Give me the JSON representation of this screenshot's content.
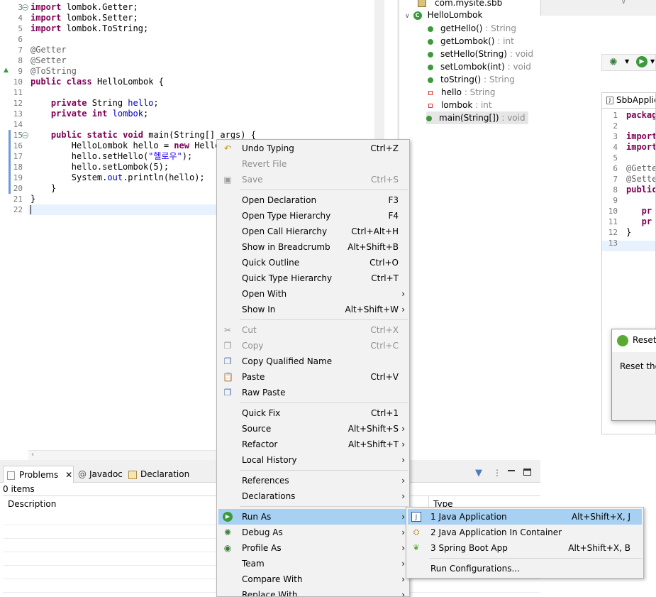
{
  "editor": {
    "lines": [
      {
        "n": "3",
        "code": [
          [
            "kw",
            "import"
          ],
          [
            "",
            " lombok.Getter;"
          ]
        ],
        "fold": true
      },
      {
        "n": "4",
        "code": [
          [
            "kw",
            "import"
          ],
          [
            "",
            " lombok.Setter;"
          ]
        ]
      },
      {
        "n": "5",
        "code": [
          [
            "kw",
            "import"
          ],
          [
            "",
            " lombok.ToString;"
          ]
        ]
      },
      {
        "n": "6",
        "code": []
      },
      {
        "n": "7",
        "code": [
          [
            "ann",
            "@Getter"
          ]
        ]
      },
      {
        "n": "8",
        "code": [
          [
            "ann",
            "@Setter"
          ]
        ]
      },
      {
        "n": "9",
        "code": [
          [
            "ann",
            "@ToString"
          ]
        ]
      },
      {
        "n": "10",
        "code": [
          [
            "kw",
            "public"
          ],
          [
            "",
            " "
          ],
          [
            "kw",
            "class"
          ],
          [
            "",
            " HelloLombok {"
          ]
        ]
      },
      {
        "n": "11",
        "code": []
      },
      {
        "n": "12",
        "code": [
          [
            "",
            "    "
          ],
          [
            "kw",
            "private"
          ],
          [
            "",
            " String "
          ],
          [
            "fld",
            "hello"
          ],
          [
            "",
            ";"
          ]
        ]
      },
      {
        "n": "13",
        "code": [
          [
            "",
            "    "
          ],
          [
            "kw",
            "private"
          ],
          [
            "",
            " "
          ],
          [
            "kw",
            "int"
          ],
          [
            "",
            " "
          ],
          [
            "fld",
            "lombok"
          ],
          [
            "",
            ";"
          ]
        ]
      },
      {
        "n": "14",
        "code": []
      },
      {
        "n": "15",
        "code": [
          [
            "",
            "    "
          ],
          [
            "kw",
            "public"
          ],
          [
            "",
            " "
          ],
          [
            "kw",
            "static"
          ],
          [
            "",
            " "
          ],
          [
            "kw",
            "void"
          ],
          [
            "",
            " main(String[] args) {"
          ]
        ],
        "fold": true
      },
      {
        "n": "16",
        "code": [
          [
            "",
            "        HelloLombok hello = "
          ],
          [
            "kw",
            "new"
          ],
          [
            "",
            " HelloL"
          ]
        ]
      },
      {
        "n": "17",
        "code": [
          [
            "",
            "        hello.setHello("
          ],
          [
            "str",
            "\"헬로우\""
          ],
          [
            "",
            ");"
          ]
        ]
      },
      {
        "n": "18",
        "code": [
          [
            "",
            "        hello.setLombok(5);"
          ]
        ]
      },
      {
        "n": "19",
        "code": [
          [
            "",
            "        System."
          ],
          [
            "fld",
            "out"
          ],
          [
            "",
            ".println(hello);"
          ]
        ]
      },
      {
        "n": "20",
        "code": [
          [
            "",
            "    }"
          ]
        ]
      },
      {
        "n": "21",
        "code": [
          [
            "",
            "}"
          ]
        ]
      },
      {
        "n": "22",
        "code": []
      }
    ]
  },
  "outline": {
    "package": "com.mysite.sbb",
    "class": "HelloLombok",
    "members": [
      {
        "name": "getHello()",
        "type": " : String",
        "kind": "method"
      },
      {
        "name": "getLombok()",
        "type": " : int",
        "kind": "method"
      },
      {
        "name": "setHello(String)",
        "type": " : void",
        "kind": "method"
      },
      {
        "name": "setLombok(int)",
        "type": " : void",
        "kind": "method"
      },
      {
        "name": "toString()",
        "type": " : String",
        "kind": "method"
      },
      {
        "name": "hello",
        "type": " : String",
        "kind": "field"
      },
      {
        "name": "lombok",
        "type": " : int",
        "kind": "field"
      },
      {
        "name": "main(String[])",
        "type": " : void",
        "kind": "method"
      }
    ]
  },
  "right": {
    "tab_label": "SbbApplica",
    "lines": [
      {
        "n": "1",
        "code": [
          [
            "kw",
            "packag"
          ]
        ]
      },
      {
        "n": "2",
        "code": []
      },
      {
        "n": "3",
        "code": [
          [
            "kw",
            "import"
          ]
        ]
      },
      {
        "n": "4",
        "code": [
          [
            "kw",
            "import"
          ]
        ]
      },
      {
        "n": "5",
        "code": []
      },
      {
        "n": "6",
        "code": [
          [
            "ann",
            "@Gette"
          ]
        ]
      },
      {
        "n": "7",
        "code": [
          [
            "ann",
            "@Sette"
          ]
        ]
      },
      {
        "n": "8",
        "code": [
          [
            "kw",
            "public"
          ]
        ]
      },
      {
        "n": "9",
        "code": []
      },
      {
        "n": "10",
        "code": [
          [
            "kw",
            "   pr"
          ]
        ]
      },
      {
        "n": "11",
        "code": [
          [
            "kw",
            "   pr"
          ]
        ]
      },
      {
        "n": "12",
        "code": [
          [
            "",
            "}"
          ]
        ]
      },
      {
        "n": "13",
        "code": []
      }
    ],
    "dialog_title": "Reset",
    "dialog_body": "Reset the"
  },
  "bottom": {
    "tabs": [
      "Problems",
      "Javadoc",
      "Declaration"
    ],
    "items_count": "0 items",
    "columns": [
      "Description",
      "Type"
    ]
  },
  "context_menu": {
    "items": [
      {
        "label": "Undo Typing",
        "shortcut": "Ctrl+Z",
        "icon": "undo-icon"
      },
      {
        "label": "Revert File",
        "shortcut": "",
        "disabled": true
      },
      {
        "label": "Save",
        "shortcut": "Ctrl+S",
        "disabled": true,
        "icon": "save-icon"
      },
      {
        "sep": true
      },
      {
        "label": "Open Declaration",
        "shortcut": "F3"
      },
      {
        "label": "Open Type Hierarchy",
        "shortcut": "F4"
      },
      {
        "label": "Open Call Hierarchy",
        "shortcut": "Ctrl+Alt+H"
      },
      {
        "label": "Show in Breadcrumb",
        "shortcut": "Alt+Shift+B"
      },
      {
        "label": "Quick Outline",
        "shortcut": "Ctrl+O"
      },
      {
        "label": "Quick Type Hierarchy",
        "shortcut": "Ctrl+T"
      },
      {
        "label": "Open With",
        "shortcut": "",
        "submenu": true
      },
      {
        "label": "Show In",
        "shortcut": "Alt+Shift+W",
        "submenu": true
      },
      {
        "sep": true
      },
      {
        "label": "Cut",
        "shortcut": "Ctrl+X",
        "disabled": true,
        "icon": "cut-icon"
      },
      {
        "label": "Copy",
        "shortcut": "Ctrl+C",
        "disabled": true,
        "icon": "copy-icon"
      },
      {
        "label": "Copy Qualified Name",
        "shortcut": "",
        "icon": "copy-qualified-icon"
      },
      {
        "label": "Paste",
        "shortcut": "Ctrl+V",
        "icon": "paste-icon"
      },
      {
        "label": "Raw Paste",
        "shortcut": "",
        "icon": "raw-paste-icon"
      },
      {
        "sep": true
      },
      {
        "label": "Quick Fix",
        "shortcut": "Ctrl+1"
      },
      {
        "label": "Source",
        "shortcut": "Alt+Shift+S",
        "submenu": true
      },
      {
        "label": "Refactor",
        "shortcut": "Alt+Shift+T",
        "submenu": true
      },
      {
        "label": "Local History",
        "shortcut": "",
        "submenu": true
      },
      {
        "sep": true
      },
      {
        "label": "References",
        "shortcut": "",
        "submenu": true
      },
      {
        "label": "Declarations",
        "shortcut": "",
        "submenu": true
      },
      {
        "sep": true
      },
      {
        "label": "Run As",
        "shortcut": "",
        "submenu": true,
        "highlight": true,
        "icon": "run-icon"
      },
      {
        "label": "Debug As",
        "shortcut": "",
        "submenu": true,
        "icon": "debug-icon"
      },
      {
        "label": "Profile As",
        "shortcut": "",
        "submenu": true,
        "icon": "profile-icon"
      },
      {
        "label": "Team",
        "shortcut": "",
        "submenu": true
      },
      {
        "label": "Compare With",
        "shortcut": "",
        "submenu": true
      },
      {
        "label": "Replace With",
        "shortcut": "",
        "submenu": true
      }
    ]
  },
  "run_as_submenu": {
    "items": [
      {
        "label": "1 Java Application",
        "shortcut": "Alt+Shift+X, J",
        "icon": "java-app-icon",
        "highlight": true
      },
      {
        "label": "2 Java Application In Container",
        "shortcut": "",
        "icon": "container-icon"
      },
      {
        "label": "3 Spring Boot App",
        "shortcut": "Alt+Shift+X, B",
        "icon": "spring-leaf-icon"
      },
      {
        "sep": true
      },
      {
        "label": "Run Configurations...",
        "shortcut": ""
      }
    ]
  }
}
